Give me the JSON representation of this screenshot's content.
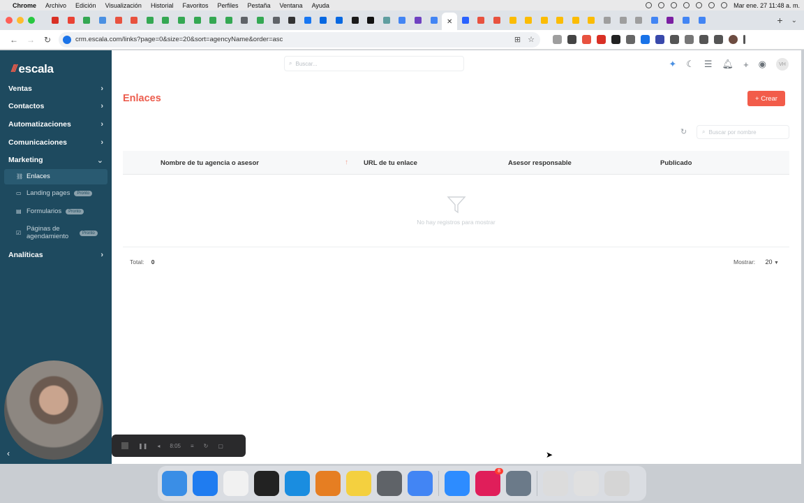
{
  "menubar": {
    "app": "Chrome",
    "items": [
      "Archivo",
      "Edición",
      "Visualización",
      "Historial",
      "Favoritos",
      "Perfiles",
      "Pestaña",
      "Ventana",
      "Ayuda"
    ],
    "datetime": "Mar ene. 27  11:48 a. m."
  },
  "browser": {
    "url": "crm.escala.com/links?page=0&size=20&sort=agencyName&order=asc",
    "tab_colors": [
      "#d93025",
      "#ea4335",
      "#34a853",
      "#4a90e2",
      "#e8523f",
      "#e8523f",
      "#34a853",
      "#34a853",
      "#34a853",
      "#34a853",
      "#34a853",
      "#34a853",
      "#5f6368",
      "#34a853",
      "#5f6368",
      "#333333",
      "#1877f2",
      "#0668e1",
      "#0668e1",
      "#1a1a1a",
      "#111111",
      "#5f9ea0",
      "#4285f4",
      "#6f42c1",
      "#4285f4",
      "#2962ff",
      "#e8523f",
      "#e8523f",
      "#fbbc04",
      "#fbbc04",
      "#fbbc04",
      "#fbbc04",
      "#fbbc04",
      "#fbbc04",
      "#9e9e9e",
      "#9e9e9e",
      "#9e9e9e",
      "#4285f4",
      "#7b1fa2",
      "#4285f4",
      "#4285f4"
    ]
  },
  "sidebar": {
    "logo_text": "escala",
    "items": [
      {
        "label": "Ventas"
      },
      {
        "label": "Contactos"
      },
      {
        "label": "Automatizaciones"
      },
      {
        "label": "Comunicaciones"
      },
      {
        "label": "Marketing"
      }
    ],
    "sub_items": [
      {
        "label": "Enlaces",
        "badge": ""
      },
      {
        "label": "Landing pages",
        "badge": "Pronto"
      },
      {
        "label": "Formularios",
        "badge": "Pronto"
      },
      {
        "label": "Páginas de agendamiento",
        "badge": "Pronto"
      }
    ],
    "last_item": {
      "label": "Analíticas"
    }
  },
  "topbar": {
    "search_placeholder": "Buscar...",
    "avatar_initials": "VH"
  },
  "page": {
    "title": "Enlaces",
    "create_label": "+ Crear",
    "table_search_placeholder": "Buscar por nombre",
    "columns": [
      "Nombre de tu agencia o asesor",
      "URL de tu enlace",
      "Asesor responsable",
      "Publicado"
    ],
    "empty_message": "No hay registros para mostrar",
    "total_label": "Total:",
    "total_value": "0",
    "mostrar_label": "Mostrar:",
    "page_size": "20"
  },
  "recording": {
    "timer": "8:05"
  },
  "dock": {
    "icon_colors": [
      "#3a8ee6",
      "#1f7cf0",
      "#f1f1f1",
      "#222222",
      "#1a8de0",
      "#e67e22",
      "#f4d03f",
      "#5f6368",
      "#4285f4",
      "#2d8cff",
      "#e01e5a",
      "#6b7a89",
      "#dcdcdc",
      "#e0e0e0",
      "#d5d5d5"
    ],
    "badge_count": "8"
  }
}
